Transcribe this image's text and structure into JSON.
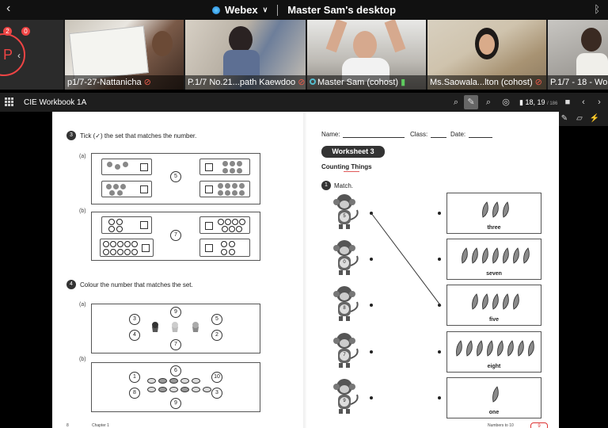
{
  "topbar": {
    "app": "Webex",
    "title": "Master Sam's desktop"
  },
  "self_tile": {
    "initial": "P",
    "badge_left": "2",
    "badge_right": "0"
  },
  "participants": [
    {
      "name": "p1/7-27-Nattanicha",
      "muted": true
    },
    {
      "name": "P.1/7 No.21...path Kaewdoo",
      "muted": true
    },
    {
      "name": "Master Sam (cohost)",
      "muted": false,
      "host_icon": true
    },
    {
      "name": "Ms.Saowala...lton (cohost)",
      "muted": true
    },
    {
      "name": "P.1/7 - 18 - Wora",
      "muted": false
    }
  ],
  "toolbar": {
    "doc_name": "CIE Workbook 1A",
    "pages": "18, 19",
    "page_total": "/ 186"
  },
  "left_page": {
    "q3": {
      "num": "3",
      "text": "Tick (✓) the set that matches the number.",
      "a": "(a)",
      "b": "(b)",
      "a_number": "5",
      "b_number": "7"
    },
    "q4": {
      "num": "4",
      "text": "Colour the number that matches the set.",
      "a": "(a)",
      "b": "(b)",
      "a_numbers": [
        "3",
        "4",
        "9",
        "7",
        "5",
        "2"
      ],
      "b_numbers": [
        "1",
        "8",
        "6",
        "9",
        "10",
        "3"
      ]
    },
    "footer_left": "8",
    "footer_chapter": "Chapter 1"
  },
  "right_page": {
    "name_label": "Name:",
    "class_label": "Class:",
    "date_label": "Date:",
    "worksheet": "Worksheet 3",
    "counting": "Counting Things",
    "q1_num": "1",
    "q1_text": "Match.",
    "monkeys": [
      "5",
      "0",
      "8",
      "7",
      "9"
    ],
    "banana_words": [
      "three",
      "seven",
      "five",
      "eight",
      "one"
    ],
    "banana_counts": [
      3,
      7,
      5,
      8,
      1
    ],
    "footer_right": "Numbers to 10",
    "page_num": "9"
  }
}
